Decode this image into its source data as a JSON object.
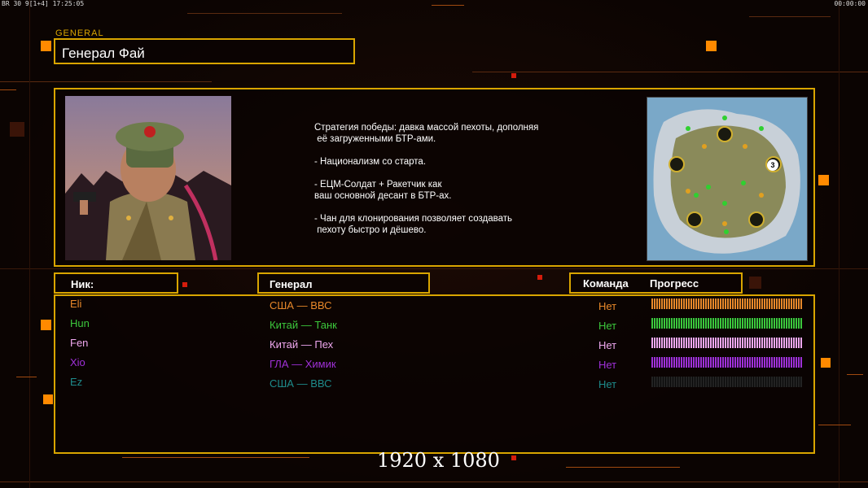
{
  "hud": {
    "top_left": "BR 30 9[1+4] 17:25:05",
    "top_right": "00:00:00"
  },
  "general_tag": "GENERAL",
  "general_name": "Генерал Фай",
  "strategy_lines": [
    "Стратегия победы: давка массой пехоты, дополняя",
    " её загруженными БТР-ами.",
    "",
    "- Национализм со старта.",
    "",
    "- ЕЦМ-Солдат + Ракетчик как",
    "ваш основной десант в БТР-ах.",
    "",
    "- Чан для клонирования позволяет создавать",
    " пехоту быстро и дёшево."
  ],
  "map": {
    "marker": "3",
    "icon": "minimap"
  },
  "headers": {
    "nick": "Ник:",
    "general": "Генерал",
    "team": "Команда",
    "progress": "Прогресс"
  },
  "players": [
    {
      "nick": "Eli",
      "general": "США — ВВС",
      "team": "Нет",
      "color": "#e8882a",
      "progress": 1.0
    },
    {
      "nick": "Hun",
      "general": "Китай — Танк",
      "team": "Нет",
      "color": "#3cc83c",
      "progress": 1.0
    },
    {
      "nick": "Fen",
      "general": "Китай — Пех",
      "team": "Нет",
      "color": "#f0a8f0",
      "progress": 1.0
    },
    {
      "nick": "Xio",
      "general": "ГЛА — Химик",
      "team": "Нет",
      "color": "#a030d8",
      "progress": 1.0
    },
    {
      "nick": "Ez",
      "general": "США — ВВС",
      "team": "Нет",
      "color": "#1e8c8c",
      "progress": 0.0
    }
  ],
  "resolution": "1920 x 1080"
}
